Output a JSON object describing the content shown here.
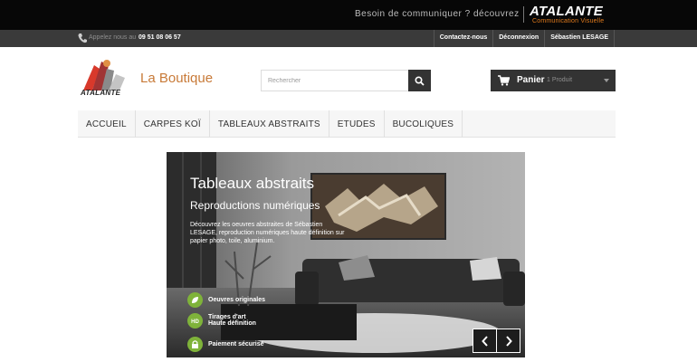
{
  "promo": {
    "text": "Besoin de communiquer ? découvrez",
    "brand": "ATALANTE",
    "brand_sub": "Communication Visuelle"
  },
  "topbar": {
    "call_label": "Appelez nous au",
    "phone": "09 51 08 06 57",
    "links": [
      "Contactez-nous",
      "Déconnexion",
      "Sébastien LESAGE"
    ]
  },
  "header": {
    "logo_word": "ATALANTE",
    "shop_title": "La Boutique",
    "search_placeholder": "Rechercher",
    "cart_label": "Panier",
    "cart_count": "1 Produit"
  },
  "menu": {
    "items": [
      "ACCUEIL",
      "CARPES KOÏ",
      "TABLEAUX ABSTRAITS",
      "ETUDES",
      "BUCOLIQUES"
    ]
  },
  "slider": {
    "title": "Tableaux abstraits",
    "subtitle": "Reproductions numériques",
    "description": "Découvrez les oeuvres abstraites de Sébastien LESAGE, reproduction numériques haute définition sur papier photo, toile, aluminium.",
    "features": [
      {
        "line1": "Oeuvres originales",
        "line2": ""
      },
      {
        "line1": "Tirages d'art",
        "line2": "Haute définition"
      },
      {
        "line1": "Paiement sécurisé",
        "line2": ""
      }
    ]
  },
  "colors": {
    "accent_orange": "#c87a38",
    "badge_green": "#7fb33a",
    "dark_bar": "#3a3a3a"
  }
}
